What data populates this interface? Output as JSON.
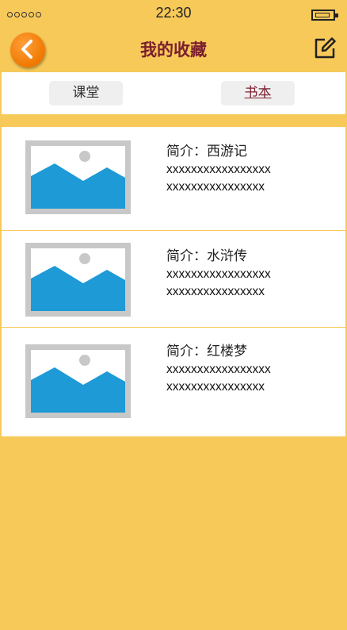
{
  "status_bar": {
    "signal_dots": 5,
    "time": "22:30",
    "battery_icon": "battery-icon"
  },
  "nav": {
    "back_icon": "chevron-left-icon",
    "title": "我的收藏",
    "edit_icon": "edit-icon"
  },
  "tabs": [
    {
      "label": "课堂",
      "selected": false
    },
    {
      "label": "书本",
      "selected": true
    }
  ],
  "favorites": [
    {
      "intro": "简介：西游记",
      "desc_lines": [
        "xxxxxxxxxxxxxxxxx",
        "xxxxxxxxxxxxxxxx"
      ],
      "thumbnail_icon": "image-placeholder-icon"
    },
    {
      "intro": "简介：水浒传",
      "desc_lines": [
        "xxxxxxxxxxxxxxxxx",
        "xxxxxxxxxxxxxxxx"
      ],
      "thumbnail_icon": "image-placeholder-icon"
    },
    {
      "intro": "简介：红楼梦",
      "desc_lines": [
        "xxxxxxxxxxxxxxxxx",
        "xxxxxxxxxxxxxxxx"
      ],
      "thumbnail_icon": "image-placeholder-icon"
    }
  ],
  "colors": {
    "background": "#F7C959",
    "title": "#7A1E2E",
    "back_button": "#F07800",
    "image_sky": "#1E9AD6",
    "image_frame": "#C8C8C8"
  }
}
